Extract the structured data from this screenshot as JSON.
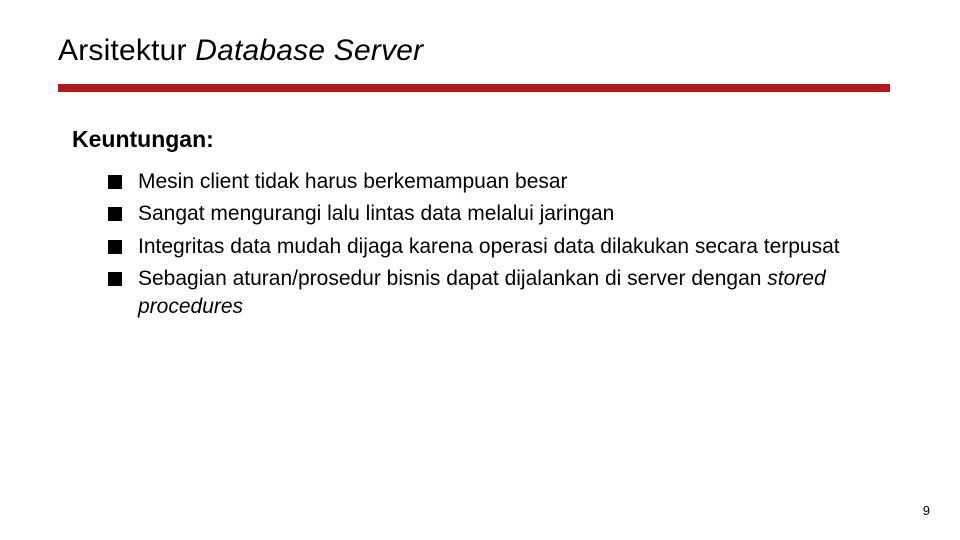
{
  "title": {
    "plain": "Arsitektur ",
    "italic": "Database Server"
  },
  "subhead": "Keuntungan:",
  "bullets": [
    {
      "text": "Mesin client tidak harus berkemampuan besar"
    },
    {
      "text": "Sangat mengurangi lalu lintas data melalui jaringan"
    },
    {
      "text": "Integritas data mudah dijaga karena operasi data dilakukan secara terpusat"
    },
    {
      "text_pre": "Sebagian aturan/prosedur bisnis dapat dijalankan di server dengan ",
      "text_italic": "stored procedures"
    }
  ],
  "page_number": "9",
  "colors": {
    "accent": "#b11a1a"
  }
}
